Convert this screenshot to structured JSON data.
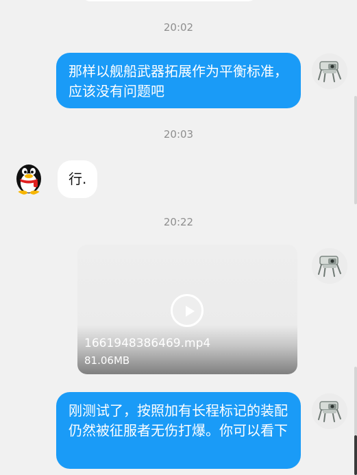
{
  "messages": [
    {
      "time": "20:02",
      "text": "那样以舰船武器拓展作为平衡标准，应该没有问题吧"
    },
    {
      "time": "20:03",
      "text": "行."
    },
    {
      "time": "20:22",
      "video": {
        "filename": "1661948386469.mp4",
        "size": "81.06MB"
      }
    },
    {
      "text": "刚测试了，按照加有长程标记的装配仍然被征服者无伤打爆。你可以看下"
    }
  ],
  "colors": {
    "self_bubble": "#1a9bf7",
    "other_bubble": "#ffffff",
    "background": "#f1f1f1",
    "timestamp": "#8e8e8e"
  },
  "icons": {
    "self_avatar": "robot-avatar-icon",
    "other_avatar": "qq-penguin-avatar-icon",
    "play": "play-icon"
  }
}
